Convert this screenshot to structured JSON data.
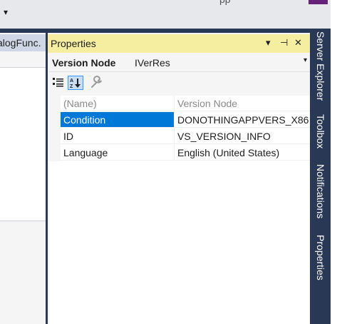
{
  "window": {
    "overflow_glyph": "▾",
    "title_fragment": "pp"
  },
  "left_doc": {
    "tab_label": "alogFunc."
  },
  "properties_panel": {
    "title": "Properties",
    "dropdown_icon": "▾",
    "pin_icon": "⊣",
    "close_icon": "✕",
    "object_name": "Version Node",
    "object_type": "IVerRes",
    "object_dropdown_icon": "▾",
    "toolbar": {
      "categorized": "categorized-icon",
      "alphabetical": "alphabetical-icon",
      "property_pages": "wrench-icon"
    },
    "rows": [
      {
        "name": "(Name)",
        "value": "Version Node",
        "state": "disabled"
      },
      {
        "name": "Condition",
        "value": "DONOTHINGAPPVERS_X86",
        "state": "selected"
      },
      {
        "name": "ID",
        "value": "VS_VERSION_INFO",
        "state": "normal"
      },
      {
        "name": "Language",
        "value": "English (United States)",
        "state": "normal"
      }
    ]
  },
  "side_tabs": [
    "Server Explorer",
    "Toolbox",
    "Notifications",
    "Properties"
  ],
  "colors": {
    "title_active": "#f5eda0",
    "selection": "#0078d7",
    "frame": "#293955",
    "accent": "#68217a"
  }
}
